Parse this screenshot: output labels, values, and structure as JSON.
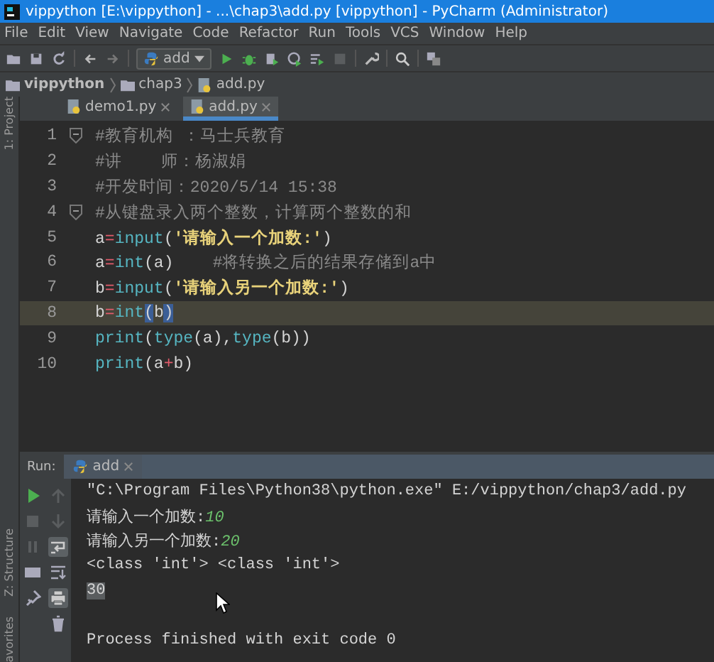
{
  "window": {
    "title": "vippython [E:\\vippython] - ...\\chap3\\add.py [vippython] - PyCharm (Administrator)"
  },
  "menu": [
    "File",
    "Edit",
    "View",
    "Navigate",
    "Code",
    "Refactor",
    "Run",
    "Tools",
    "VCS",
    "Window",
    "Help"
  ],
  "toolbar": {
    "run_config": "add"
  },
  "breadcrumb": [
    "vippython",
    "chap3",
    "add.py"
  ],
  "left_strip": {
    "top": [
      "1: Project"
    ],
    "bottom": [
      "Z: Structure",
      "avorites"
    ]
  },
  "editor_tabs": [
    {
      "label": "demo1.py",
      "selected": false
    },
    {
      "label": "add.py",
      "selected": true
    }
  ],
  "code": [
    {
      "number": "1",
      "fold": true,
      "current": false,
      "tokens": [
        {
          "kind": "comment",
          "text": "#教育机构 ：马士兵教育"
        }
      ]
    },
    {
      "number": "2",
      "fold": false,
      "current": false,
      "tokens": [
        {
          "kind": "comment",
          "text": "#讲    师：杨淑娟"
        }
      ]
    },
    {
      "number": "3",
      "fold": false,
      "current": false,
      "tokens": [
        {
          "kind": "comment",
          "text": "#开发时间：2020/5/14 15:38"
        }
      ]
    },
    {
      "number": "4",
      "fold": true,
      "current": false,
      "tokens": [
        {
          "kind": "comment",
          "text": "#从键盘录入两个整数，计算两个整数的和"
        }
      ]
    },
    {
      "number": "5",
      "fold": false,
      "current": false,
      "tokens": [
        {
          "kind": "plain",
          "text": "a"
        },
        {
          "kind": "op",
          "text": "="
        },
        {
          "kind": "builtin",
          "text": "input"
        },
        {
          "kind": "plain",
          "text": "("
        },
        {
          "kind": "string",
          "text": "'请输入一个加数:'"
        },
        {
          "kind": "plain",
          "text": ")"
        }
      ]
    },
    {
      "number": "6",
      "fold": false,
      "current": false,
      "tokens": [
        {
          "kind": "plain",
          "text": "a"
        },
        {
          "kind": "op",
          "text": "="
        },
        {
          "kind": "builtin",
          "text": "int"
        },
        {
          "kind": "plain",
          "text": "(a)    "
        },
        {
          "kind": "comment",
          "text": "#将转换之后的结果存储到a中"
        }
      ]
    },
    {
      "number": "7",
      "fold": false,
      "current": false,
      "tokens": [
        {
          "kind": "plain",
          "text": "b"
        },
        {
          "kind": "op",
          "text": "="
        },
        {
          "kind": "builtin",
          "text": "input"
        },
        {
          "kind": "plain",
          "text": "("
        },
        {
          "kind": "string",
          "text": "'请输入另一个加数:'"
        },
        {
          "kind": "plain",
          "text": ")"
        }
      ]
    },
    {
      "number": "8",
      "fold": false,
      "current": true,
      "tokens": [
        {
          "kind": "plain",
          "text": "b"
        },
        {
          "kind": "op",
          "text": "="
        },
        {
          "kind": "builtin",
          "text": "int"
        },
        {
          "kind": "matched_paren",
          "text": "("
        },
        {
          "kind": "plain",
          "text": "b"
        },
        {
          "kind": "matched_paren",
          "text": ")"
        }
      ]
    },
    {
      "number": "9",
      "fold": false,
      "current": false,
      "tokens": [
        {
          "kind": "builtin",
          "text": "print"
        },
        {
          "kind": "plain",
          "text": "("
        },
        {
          "kind": "builtin",
          "text": "type"
        },
        {
          "kind": "plain",
          "text": "(a),"
        },
        {
          "kind": "builtin",
          "text": "type"
        },
        {
          "kind": "plain",
          "text": "(b))"
        }
      ]
    },
    {
      "number": "10",
      "fold": false,
      "current": false,
      "tokens": [
        {
          "kind": "builtin",
          "text": "print"
        },
        {
          "kind": "plain",
          "text": "(a"
        },
        {
          "kind": "op",
          "text": "+"
        },
        {
          "kind": "plain",
          "text": "b)"
        }
      ]
    }
  ],
  "run_panel": {
    "label": "Run:",
    "tab": "add",
    "tools_left": [
      {
        "kind": "run",
        "on": false
      },
      {
        "kind": "stop",
        "on": false
      },
      {
        "kind": "pause",
        "on": false
      },
      {
        "kind": "layout",
        "on": false
      },
      {
        "kind": "pin",
        "on": false
      }
    ],
    "tools_right": [
      {
        "kind": "up",
        "on": false
      },
      {
        "kind": "down",
        "on": false
      },
      {
        "kind": "wrap",
        "on": true
      },
      {
        "kind": "scroll_end",
        "on": false
      },
      {
        "kind": "print",
        "on": true
      },
      {
        "kind": "trash",
        "on": false
      }
    ],
    "console": [
      {
        "kind": "text",
        "tokens": [
          {
            "kind": "output",
            "text": "\"C:\\Program Files\\Python38\\python.exe\" E:/vippython/chap3/add.py"
          }
        ]
      },
      {
        "kind": "text",
        "tokens": [
          {
            "kind": "output",
            "text": "请输入一个加数:"
          },
          {
            "kind": "input",
            "text": "10"
          }
        ]
      },
      {
        "kind": "text",
        "tokens": [
          {
            "kind": "output",
            "text": "请输入另一个加数:"
          },
          {
            "kind": "input",
            "text": "20"
          }
        ]
      },
      {
        "kind": "text",
        "tokens": [
          {
            "kind": "output",
            "text": "<class 'int'> <class 'int'>"
          }
        ]
      },
      {
        "kind": "text",
        "tokens": [
          {
            "kind": "selected_output",
            "text": "30"
          }
        ]
      },
      {
        "kind": "blank"
      },
      {
        "kind": "text",
        "tokens": [
          {
            "kind": "output",
            "text": "Process finished with exit code 0"
          }
        ]
      }
    ]
  }
}
